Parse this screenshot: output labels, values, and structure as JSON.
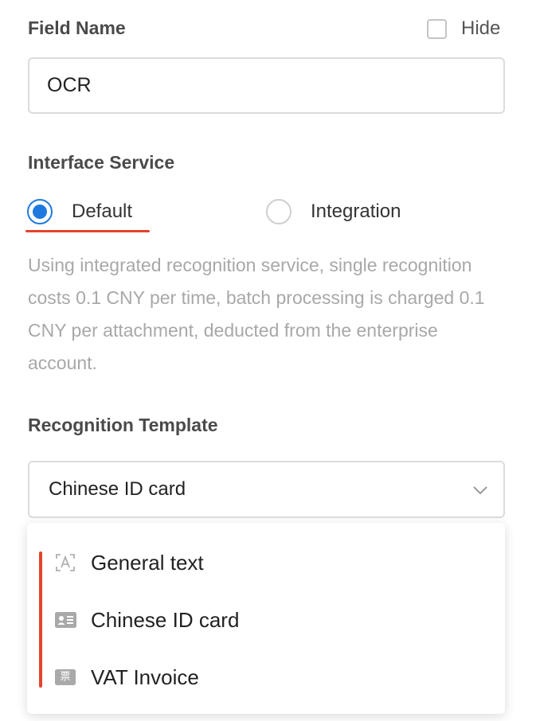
{
  "field_name": {
    "label": "Field Name",
    "value": "OCR",
    "hide_label": "Hide",
    "hide_checked": false
  },
  "interface_service": {
    "label": "Interface Service",
    "options": [
      {
        "label": "Default",
        "selected": true
      },
      {
        "label": "Integration",
        "selected": false
      }
    ],
    "description": "Using integrated recognition service, single recognition costs 0.1 CNY per time, batch processing is charged 0.1 CNY per attachment, deducted from the enterprise account."
  },
  "recognition_template": {
    "label": "Recognition Template",
    "selected": "Chinese ID card",
    "options": [
      {
        "label": "General text",
        "icon": "text-scan-icon"
      },
      {
        "label": "Chinese ID card",
        "icon": "id-card-icon"
      },
      {
        "label": "VAT Invoice",
        "icon": "invoice-icon",
        "icon_glyph": "票"
      }
    ]
  },
  "colors": {
    "accent": "#1f7ae0",
    "highlight": "#e4432b",
    "muted_text": "#a8a8a8"
  }
}
